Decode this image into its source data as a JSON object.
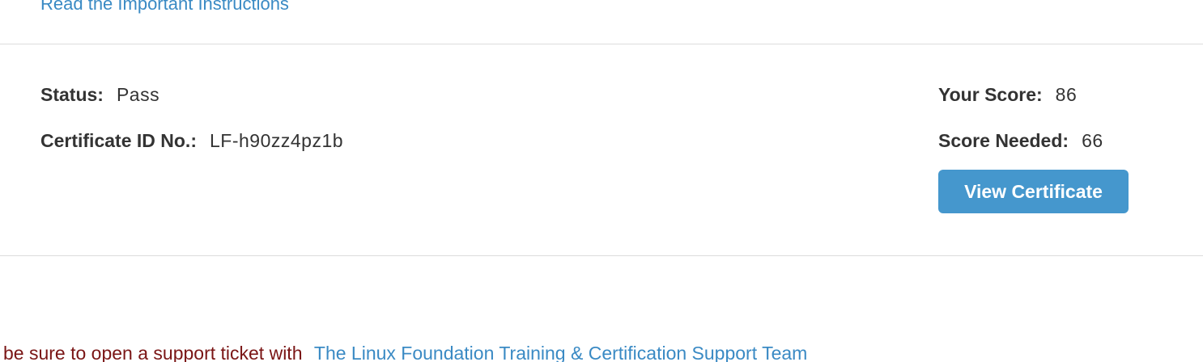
{
  "header": {
    "instructions_link": "Read the Important Instructions"
  },
  "result": {
    "status_label": "Status:",
    "status_value": "Pass",
    "certificate_label": "Certificate ID No.:",
    "certificate_value": "LF-h90zz4pz1b",
    "score_label": "Your Score:",
    "score_value": "86",
    "needed_label": "Score Needed:",
    "needed_value": "66",
    "view_certificate_label": "View Certificate"
  },
  "footer": {
    "support_text": "be sure to open a support ticket with",
    "support_link": "The Linux Foundation Training & Certification Support Team"
  },
  "colors": {
    "link": "#3a8ac4",
    "button": "#4597cd",
    "warning_text": "#7a1515",
    "divider": "#dcdcdc"
  }
}
